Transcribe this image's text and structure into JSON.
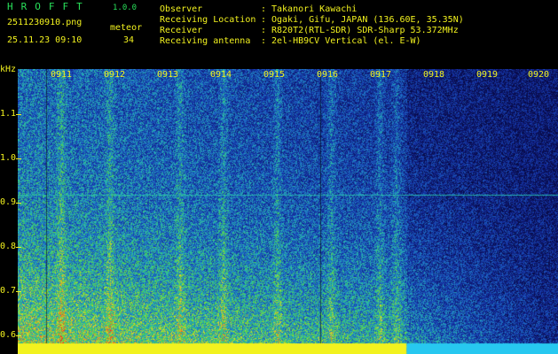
{
  "app": {
    "logo": "HROFFT",
    "version": "1.0.0",
    "filename": "2511230910.png",
    "datetime": "25.11.23 09:10",
    "meteor_label": "meteor",
    "meteor_count": "34"
  },
  "info": {
    "labels": [
      "Observer",
      "Receiving Location",
      "Receiver",
      "Receiving antenna"
    ],
    "values": [
      "Takanori Kawachi",
      "Ogaki, Gifu, JAPAN (136.60E, 35.35N)",
      "R820T2(RTL-SDR) SDR-Sharp 53.372MHz",
      "2el-HB9CV Vertical (el. E-W)"
    ]
  },
  "axis": {
    "unit": "kHz",
    "y_ticks": [
      "1.1",
      "1.0",
      "0.9",
      "0.8",
      "0.7",
      "0.6"
    ],
    "x_ticks": [
      "0911",
      "0912",
      "0913",
      "0914",
      "0915",
      "0916",
      "0917",
      "0918",
      "0919",
      "0920"
    ]
  },
  "colors": {
    "background": "#000000",
    "label_green": "#28e05a",
    "label_yellow": "#f2f21e",
    "spectrum_low": "#1a2c8c",
    "spectrum_high": "#ff2020"
  }
}
